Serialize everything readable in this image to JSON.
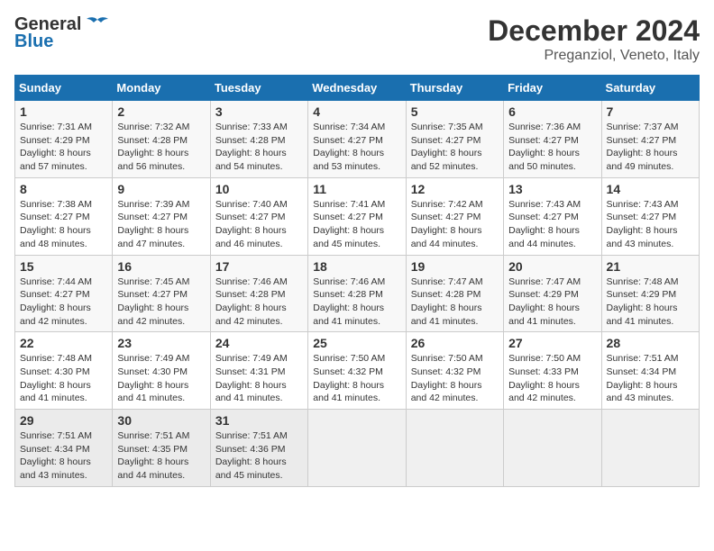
{
  "header": {
    "logo_general": "General",
    "logo_blue": "Blue",
    "month_title": "December 2024",
    "location": "Preganziol, Veneto, Italy"
  },
  "weekdays": [
    "Sunday",
    "Monday",
    "Tuesday",
    "Wednesday",
    "Thursday",
    "Friday",
    "Saturday"
  ],
  "weeks": [
    [
      {
        "day": "1",
        "sunrise": "7:31 AM",
        "sunset": "4:29 PM",
        "daylight": "8 hours and 57 minutes."
      },
      {
        "day": "2",
        "sunrise": "7:32 AM",
        "sunset": "4:28 PM",
        "daylight": "8 hours and 56 minutes."
      },
      {
        "day": "3",
        "sunrise": "7:33 AM",
        "sunset": "4:28 PM",
        "daylight": "8 hours and 54 minutes."
      },
      {
        "day": "4",
        "sunrise": "7:34 AM",
        "sunset": "4:27 PM",
        "daylight": "8 hours and 53 minutes."
      },
      {
        "day": "5",
        "sunrise": "7:35 AM",
        "sunset": "4:27 PM",
        "daylight": "8 hours and 52 minutes."
      },
      {
        "day": "6",
        "sunrise": "7:36 AM",
        "sunset": "4:27 PM",
        "daylight": "8 hours and 50 minutes."
      },
      {
        "day": "7",
        "sunrise": "7:37 AM",
        "sunset": "4:27 PM",
        "daylight": "8 hours and 49 minutes."
      }
    ],
    [
      {
        "day": "8",
        "sunrise": "7:38 AM",
        "sunset": "4:27 PM",
        "daylight": "8 hours and 48 minutes."
      },
      {
        "day": "9",
        "sunrise": "7:39 AM",
        "sunset": "4:27 PM",
        "daylight": "8 hours and 47 minutes."
      },
      {
        "day": "10",
        "sunrise": "7:40 AM",
        "sunset": "4:27 PM",
        "daylight": "8 hours and 46 minutes."
      },
      {
        "day": "11",
        "sunrise": "7:41 AM",
        "sunset": "4:27 PM",
        "daylight": "8 hours and 45 minutes."
      },
      {
        "day": "12",
        "sunrise": "7:42 AM",
        "sunset": "4:27 PM",
        "daylight": "8 hours and 44 minutes."
      },
      {
        "day": "13",
        "sunrise": "7:43 AM",
        "sunset": "4:27 PM",
        "daylight": "8 hours and 44 minutes."
      },
      {
        "day": "14",
        "sunrise": "7:43 AM",
        "sunset": "4:27 PM",
        "daylight": "8 hours and 43 minutes."
      }
    ],
    [
      {
        "day": "15",
        "sunrise": "7:44 AM",
        "sunset": "4:27 PM",
        "daylight": "8 hours and 42 minutes."
      },
      {
        "day": "16",
        "sunrise": "7:45 AM",
        "sunset": "4:27 PM",
        "daylight": "8 hours and 42 minutes."
      },
      {
        "day": "17",
        "sunrise": "7:46 AM",
        "sunset": "4:28 PM",
        "daylight": "8 hours and 42 minutes."
      },
      {
        "day": "18",
        "sunrise": "7:46 AM",
        "sunset": "4:28 PM",
        "daylight": "8 hours and 41 minutes."
      },
      {
        "day": "19",
        "sunrise": "7:47 AM",
        "sunset": "4:28 PM",
        "daylight": "8 hours and 41 minutes."
      },
      {
        "day": "20",
        "sunrise": "7:47 AM",
        "sunset": "4:29 PM",
        "daylight": "8 hours and 41 minutes."
      },
      {
        "day": "21",
        "sunrise": "7:48 AM",
        "sunset": "4:29 PM",
        "daylight": "8 hours and 41 minutes."
      }
    ],
    [
      {
        "day": "22",
        "sunrise": "7:48 AM",
        "sunset": "4:30 PM",
        "daylight": "8 hours and 41 minutes."
      },
      {
        "day": "23",
        "sunrise": "7:49 AM",
        "sunset": "4:30 PM",
        "daylight": "8 hours and 41 minutes."
      },
      {
        "day": "24",
        "sunrise": "7:49 AM",
        "sunset": "4:31 PM",
        "daylight": "8 hours and 41 minutes."
      },
      {
        "day": "25",
        "sunrise": "7:50 AM",
        "sunset": "4:32 PM",
        "daylight": "8 hours and 41 minutes."
      },
      {
        "day": "26",
        "sunrise": "7:50 AM",
        "sunset": "4:32 PM",
        "daylight": "8 hours and 42 minutes."
      },
      {
        "day": "27",
        "sunrise": "7:50 AM",
        "sunset": "4:33 PM",
        "daylight": "8 hours and 42 minutes."
      },
      {
        "day": "28",
        "sunrise": "7:51 AM",
        "sunset": "4:34 PM",
        "daylight": "8 hours and 43 minutes."
      }
    ],
    [
      {
        "day": "29",
        "sunrise": "7:51 AM",
        "sunset": "4:34 PM",
        "daylight": "8 hours and 43 minutes."
      },
      {
        "day": "30",
        "sunrise": "7:51 AM",
        "sunset": "4:35 PM",
        "daylight": "8 hours and 44 minutes."
      },
      {
        "day": "31",
        "sunrise": "7:51 AM",
        "sunset": "4:36 PM",
        "daylight": "8 hours and 45 minutes."
      },
      null,
      null,
      null,
      null
    ]
  ],
  "labels": {
    "sunrise": "Sunrise:",
    "sunset": "Sunset:",
    "daylight": "Daylight:"
  }
}
